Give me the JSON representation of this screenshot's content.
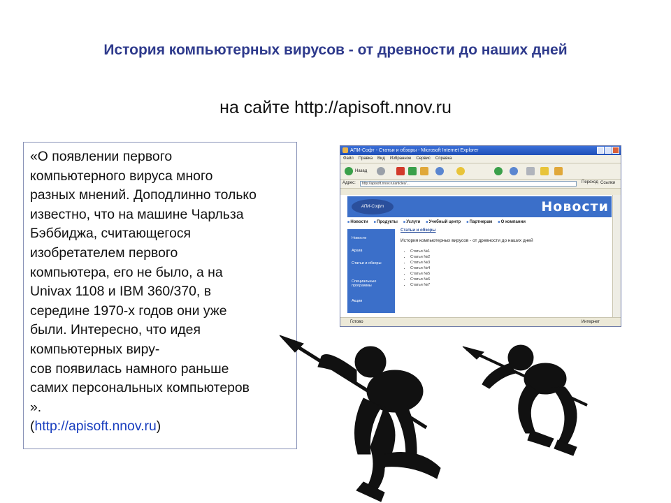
{
  "slide": {
    "title": "История компьютерных вирусов - от древности до наших дней",
    "subtitle": "на сайте http://apisoft.nnov.ru"
  },
  "quote": {
    "lines": [
      "«О появлении первого",
      "компьютерного вируса много",
      "разных мнений. Доподлинно только",
      "известно, что на машине Чарльза",
      "Бэббиджа, считающегося",
      "изобретателем первого",
      "компьютера, его не было, а на",
      "Univax 1108 и IBM 360/370, в",
      "середине 1970-х годов они уже",
      "были. Интересно, что идея",
      "компьютерных виру-",
      "сов появилась намного раньше",
      "самих персональных компьютеров",
      "»."
    ],
    "source_open": "(",
    "source_link": "http://apisoft.nnov.ru",
    "source_close": ")"
  },
  "browser": {
    "window_title": "АПИ-Софт - Статьи и обзоры - Microsoft Internet Explorer",
    "menu": [
      "Файл",
      "Правка",
      "Вид",
      "Избранное",
      "Сервис",
      "Справка"
    ],
    "back_label": "Назад",
    "address_label": "Адрес:",
    "address_value": "http://apisoft.nnov.ru/articles/...",
    "go_label": "Переход",
    "links_label": "Ссылки",
    "status_text": "Готово",
    "status_zone": "Интернет",
    "site": {
      "logo": "АПИ-Софт",
      "header": "Новости",
      "nav": [
        "Новости",
        "Продукты",
        "Услуги",
        "Учебный центр",
        "Партнерам",
        "О компании"
      ],
      "sidebar": [
        "Новости",
        "Архив",
        "Статьи и обзоры",
        "Специальные программы",
        "Акции"
      ],
      "breadcrumb": "Статьи и обзоры",
      "article_title": "История компьютерных вирусов - от древности до наших дней",
      "chapters": [
        "Статья №1",
        "Статья №2",
        "Статья №3",
        "Статья №4",
        "Статья №5",
        "Статья №6",
        "Статья №7"
      ]
    }
  },
  "colors": {
    "title": "#2e3a8c",
    "link": "#1a3fbf",
    "site_blue": "#3b6fc9",
    "silhouette": "#111111"
  },
  "image": {
    "icon": "spear-hunters-silhouette"
  }
}
